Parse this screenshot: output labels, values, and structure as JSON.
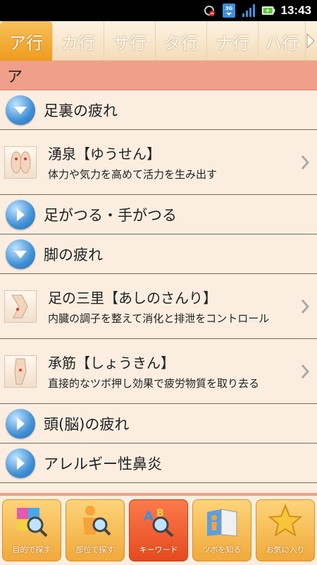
{
  "status": {
    "time": "13:43",
    "network": "3G"
  },
  "tabs": [
    {
      "label": "ア行"
    },
    {
      "label": "カ行"
    },
    {
      "label": "サ行"
    },
    {
      "label": "タ行"
    },
    {
      "label": "ナ行"
    },
    {
      "label": "ハ行"
    }
  ],
  "section": {
    "label": "ア"
  },
  "list": {
    "rows": [
      {
        "type": "category",
        "label": "足裏の疲れ"
      },
      {
        "type": "item",
        "title": "湧泉【ゆうせん】",
        "desc": "体力や気力を高めて活力を生み出す"
      },
      {
        "type": "category",
        "label": "足がつる・手がつる"
      },
      {
        "type": "category",
        "label": "脚の疲れ"
      },
      {
        "type": "item",
        "title": "足の三里【あしのさんり】",
        "desc": "内臓の調子を整えて消化と排泄をコントロール"
      },
      {
        "type": "item",
        "title": "承筋【しょうきん】",
        "desc": "直接的なツボ押し効果で疲労物質を取り去る"
      },
      {
        "type": "category",
        "label": "頭(脳)の疲れ"
      },
      {
        "type": "category",
        "label": "アレルギー性鼻炎"
      }
    ]
  },
  "bottom_nav": {
    "purpose": "目的で探す",
    "body_part": "部位で探す",
    "keyword": "キーワード",
    "learn": "ツボを知る",
    "favorites": "お気に入り"
  },
  "colors": {
    "accent": "#ee9b1d",
    "section": "#f0a08a",
    "active_button": "#e54a1e"
  }
}
